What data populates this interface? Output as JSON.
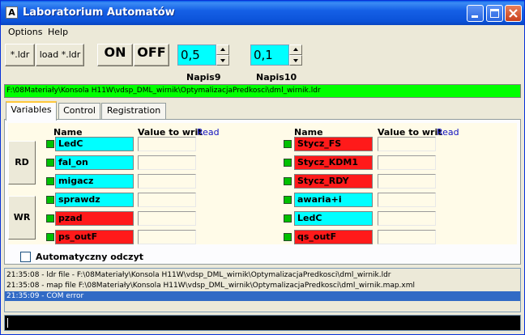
{
  "window": {
    "title": "Laboratorium Automatów",
    "app_icon": "A"
  },
  "menu": {
    "items": [
      {
        "label": "Options"
      },
      {
        "label": "Help"
      }
    ]
  },
  "toolbar": {
    "ldr_label": "*.ldr",
    "load_label": "load *.ldr",
    "on_label": "ON",
    "off_label": "OFF",
    "spin1": {
      "value": "0,5",
      "label": "Napis9"
    },
    "spin2": {
      "value": "0,1",
      "label": "Napis10"
    }
  },
  "path": "F:\\08Materiały\\Konsola H11W\\vdsp_DML_wirnik\\OptymalizacjaPredkosci\\dml_wirnik.ldr",
  "tabs": [
    {
      "label": "Variables"
    },
    {
      "label": "Control"
    },
    {
      "label": "Registration"
    }
  ],
  "variables": {
    "headers": {
      "name": "Name",
      "value": "Value to writ",
      "read": "Read"
    },
    "rd_label": "RD",
    "wr_label": "WR",
    "left": [
      {
        "name": "LedC",
        "color": "#00ffff"
      },
      {
        "name": "fal_on",
        "color": "#00ffff"
      },
      {
        "name": "migacz",
        "color": "#00ffff"
      },
      {
        "name": "sprawdz",
        "color": "#00ffff"
      },
      {
        "name": "pzad",
        "color": "#ff1a1a"
      },
      {
        "name": "ps_outF",
        "color": "#ff1a1a"
      }
    ],
    "right": [
      {
        "name": "Stycz_FS",
        "color": "#ff1a1a"
      },
      {
        "name": "Stycz_KDM1",
        "color": "#ff1a1a"
      },
      {
        "name": "Stycz_RDY",
        "color": "#ff1a1a"
      },
      {
        "name": "awaria+i",
        "color": "#00ffff"
      },
      {
        "name": "LedC",
        "color": "#00ffff"
      },
      {
        "name": "qs_outF",
        "color": "#ff1a1a"
      }
    ],
    "auto_read_label": "Automatyczny odczyt"
  },
  "log": [
    "21:35:08 - ldr file - F:\\08Materiały\\Konsola H11W\\vdsp_DML_wirnik\\OptymalizacjaPredkosci\\dml_wirnik.ldr",
    "21:35:08 - map file F:\\08Materiały\\Konsola H11W\\vdsp_DML_wirnik\\OptymalizacjaPredkosci\\dml_wirnik.map.xml",
    "21:35:09 - COM error"
  ],
  "icons": {
    "minimize": "minimize-icon",
    "maximize": "maximize-icon",
    "close": "close-icon"
  }
}
